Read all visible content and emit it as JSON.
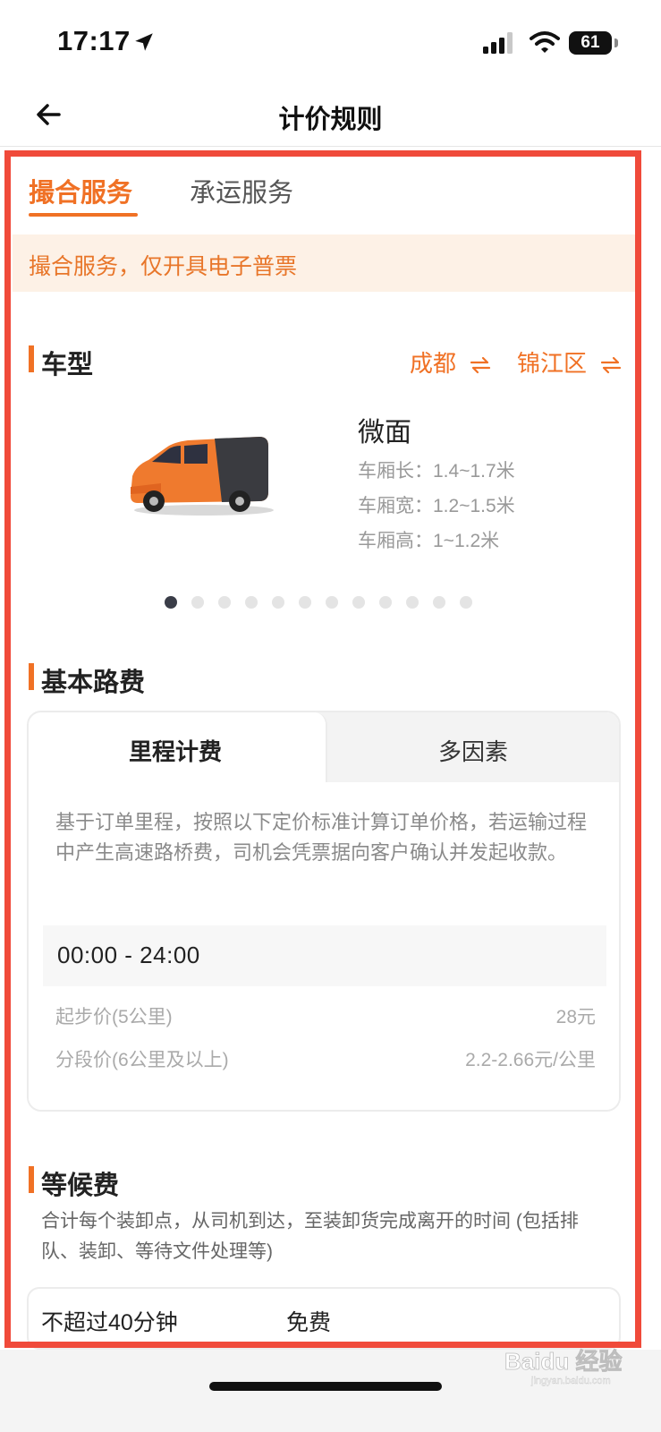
{
  "status_bar": {
    "time": "17:17",
    "battery": "61"
  },
  "nav": {
    "title": "计价规则"
  },
  "service_tabs": [
    {
      "label": "撮合服务",
      "active": true
    },
    {
      "label": "承运服务",
      "active": false
    }
  ],
  "notice": "撮合服务，仅开具电子普票",
  "vehicle_section": {
    "title": "车型",
    "city": "成都",
    "district": "锦江区",
    "vehicle": {
      "name": "微面",
      "specs": [
        "车厢长：1.4~1.7米",
        "车厢宽：1.2~1.5米",
        "车厢高：1~1.2米"
      ]
    },
    "carousel_count": 12,
    "carousel_active": 0
  },
  "base_fee": {
    "title": "基本路费",
    "tabs": [
      {
        "label": "里程计费",
        "active": true
      },
      {
        "label": "多因素",
        "active": false
      }
    ],
    "description": "基于订单里程，按照以下定价标准计算订单价格，若运输过程中产生高速路桥费，司机会凭票据向客户确认并发起收款。",
    "time_range": "00:00 - 24:00",
    "prices": [
      {
        "label": "起步价(5公里)",
        "value": "28元"
      },
      {
        "label": "分段价(6公里及以上)",
        "value": "2.2-2.66元/公里"
      }
    ]
  },
  "waiting_fee": {
    "title": "等候费",
    "description": "合计每个装卸点，从司机到达，至装卸货完成离开的时间 (包括排队、装卸、等待文件处理等)",
    "rows": [
      {
        "condition": "不超过40分钟",
        "fee": "免费"
      }
    ]
  },
  "colors": {
    "accent": "#f07125",
    "notice_bg": "#fdf1e6",
    "annotation_frame": "#f04a3a"
  },
  "icons": [
    "location-arrow-icon",
    "signal-icon",
    "wifi-icon",
    "back-arrow-icon",
    "swap-icon"
  ]
}
